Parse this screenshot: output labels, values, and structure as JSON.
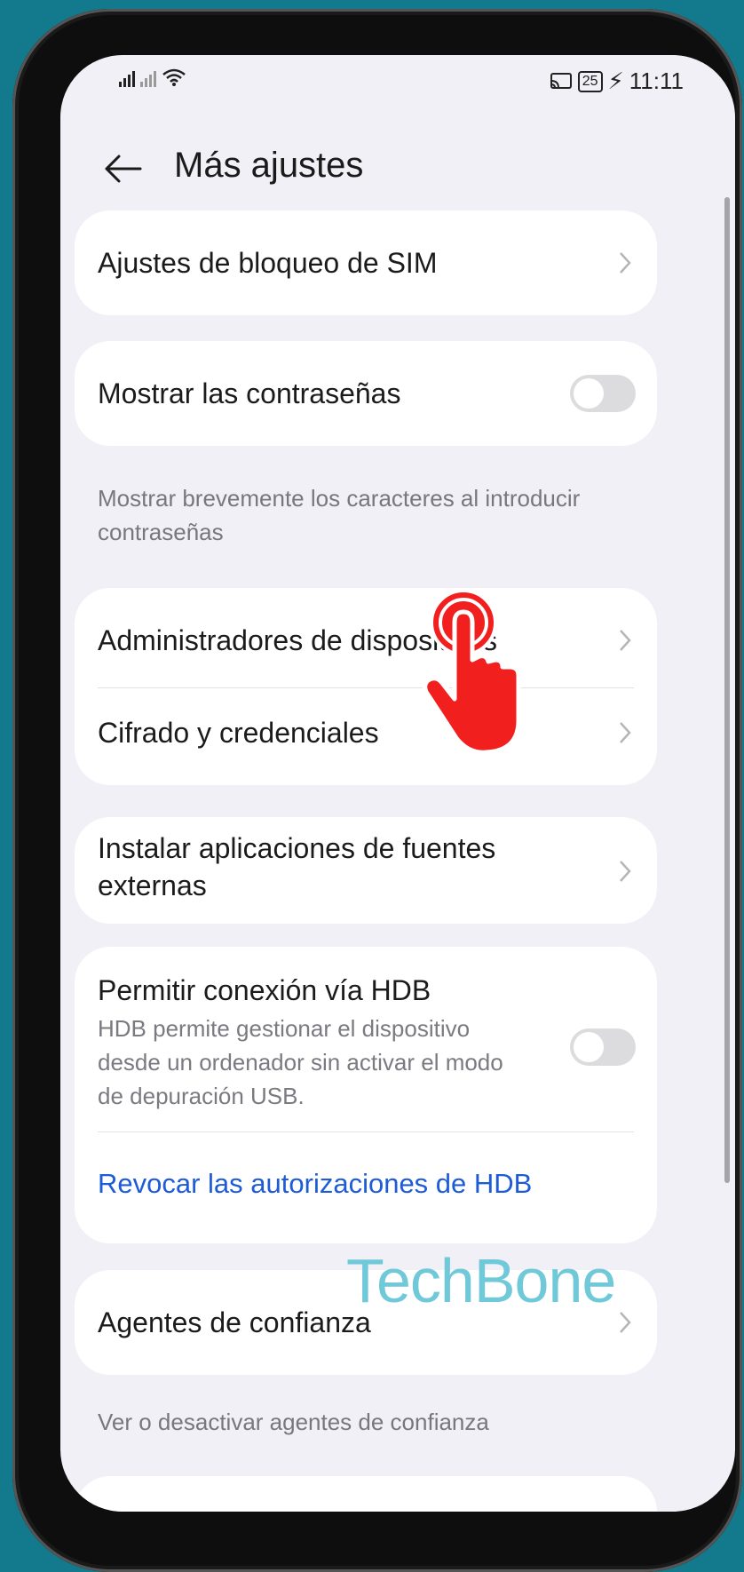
{
  "status_bar": {
    "time": "11:11",
    "battery": "25",
    "icons": [
      "signal-icon",
      "signal-no-sim-icon",
      "wifi-icon",
      "cast-icon",
      "battery-icon",
      "charging-icon"
    ]
  },
  "header": {
    "title": "Más ajustes",
    "back_icon": "arrow-left-icon"
  },
  "items": {
    "sim_lock": {
      "label": "Ajustes de bloqueo de SIM"
    },
    "show_passwords": {
      "label": "Mostrar las contraseñas",
      "toggle": "off"
    },
    "show_passwords_hint": {
      "line1": "Mostrar brevemente los caracteres al introducir",
      "line2": "contraseñas"
    },
    "device_admins": {
      "label": "Administradores de dispositivos"
    },
    "encryption": {
      "label": "Cifrado y credenciales"
    },
    "external_sources": {
      "line1": "Instalar aplicaciones de fuentes",
      "line2": "externas"
    },
    "hdb": {
      "label": "Permitir conexión vía HDB",
      "desc1": "HDB permite gestionar el dispositivo",
      "desc2": "desde un ordenador sin activar el modo",
      "desc3": "de depuración USB.",
      "toggle": "off"
    },
    "revoke_hdb": {
      "label": "Revocar las autorizaciones de HDB"
    },
    "trust_agents": {
      "label": "Agentes de confianza"
    },
    "trust_agents_hint": {
      "label": "Ver o desactivar agentes de confianza"
    }
  },
  "watermark": "TechBone",
  "colors": {
    "link": "#1e5bd7",
    "background": "#137a8e",
    "hand": "#f21f1f",
    "watermark": "#6fc9d9"
  }
}
